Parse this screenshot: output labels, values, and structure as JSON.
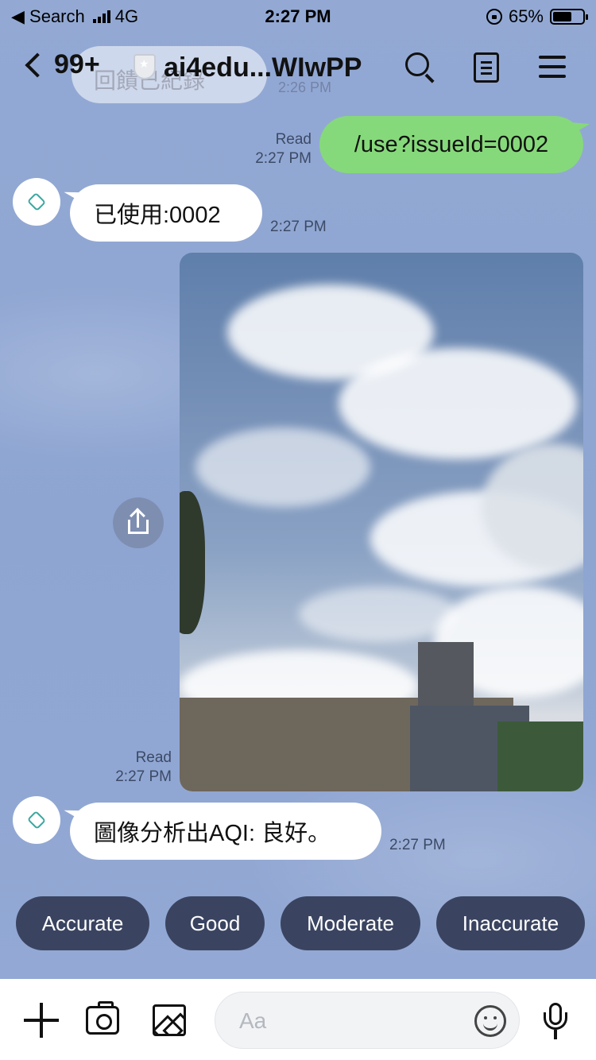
{
  "status_bar": {
    "back_app": "◀ Search",
    "network": "4G",
    "time": "2:27 PM",
    "battery_percent": "65%",
    "battery_level": 0.65
  },
  "header": {
    "unread_count": "99+",
    "title": "ai4edu...WIwPP",
    "ghost_message": "回饋已紀錄",
    "ghost_time": "2:26 PM",
    "icons": [
      "chevron-left-icon",
      "shield-icon",
      "search-icon",
      "note-icon",
      "menu-icon"
    ]
  },
  "messages": [
    {
      "direction": "out",
      "text": "/use?issueId=0002",
      "status": "Read",
      "time": "2:27 PM"
    },
    {
      "direction": "in",
      "text": "已使用:0002",
      "time": "2:27 PM"
    },
    {
      "direction": "out",
      "type": "photo",
      "status": "Read",
      "time": "2:27 PM"
    },
    {
      "direction": "in",
      "text": "圖像分析出AQI: 良好。",
      "time": "2:27 PM"
    }
  ],
  "quick_replies": [
    "Accurate",
    "Good",
    "Moderate",
    "Inaccurate"
  ],
  "input": {
    "placeholder": "Aa",
    "icons": [
      "plus-icon",
      "camera-icon",
      "image-icon",
      "emoji-icon",
      "mic-icon"
    ]
  },
  "colors": {
    "background": "#8ea6d2",
    "outgoing_bubble": "#86d97a",
    "incoming_bubble": "#ffffff",
    "quick_reply": "#3a4461"
  }
}
